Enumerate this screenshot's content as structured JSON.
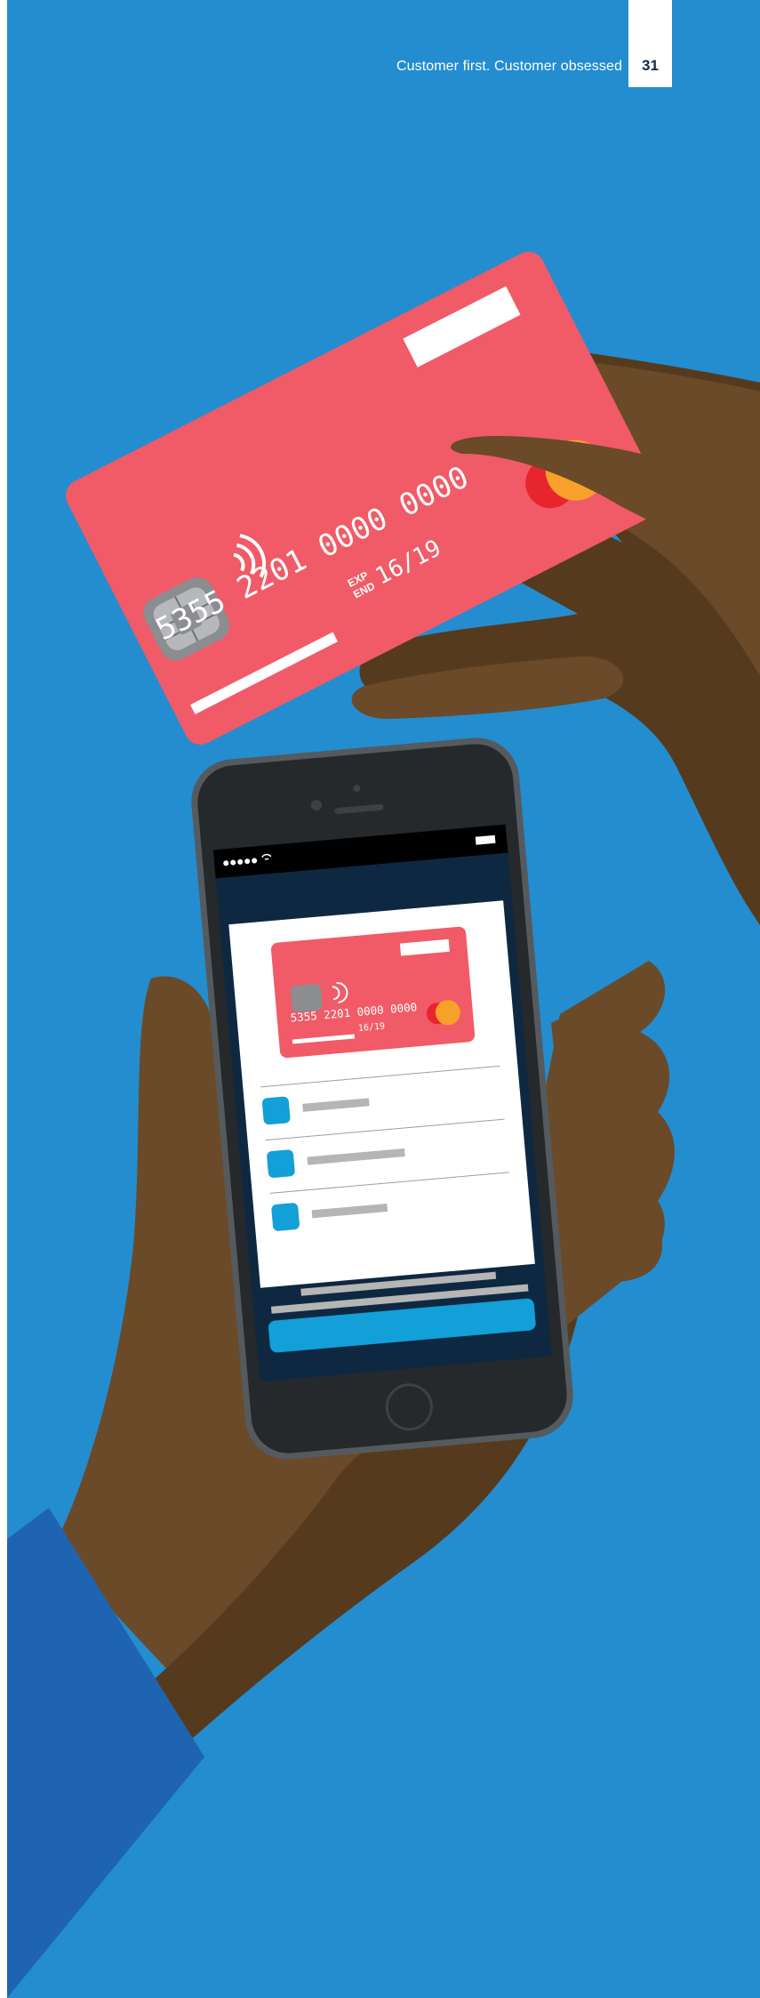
{
  "header": {
    "tagline": "Customer first. Customer obsessed",
    "page_number": "31"
  },
  "card": {
    "number": "5355 2201 0000 0000",
    "exp_label_top": "EXP",
    "exp_label_bottom": "END",
    "expiry": "16/19"
  },
  "phone_card": {
    "number": "5355 2201 0000 0000",
    "expiry": "16/19"
  },
  "colors": {
    "background": "#238dcf",
    "card": "#f05b67",
    "skin_dark": "#553a1e",
    "skin_light": "#6a4a28",
    "sleeve": "#1f64b0",
    "phone_body": "#25292c",
    "screen_header": "#0e2842",
    "accent_button": "#139fd8"
  },
  "icons": [
    "contactless-icon",
    "chip-icon",
    "mastercard-logo-icon",
    "wifi-icon",
    "battery-icon"
  ]
}
